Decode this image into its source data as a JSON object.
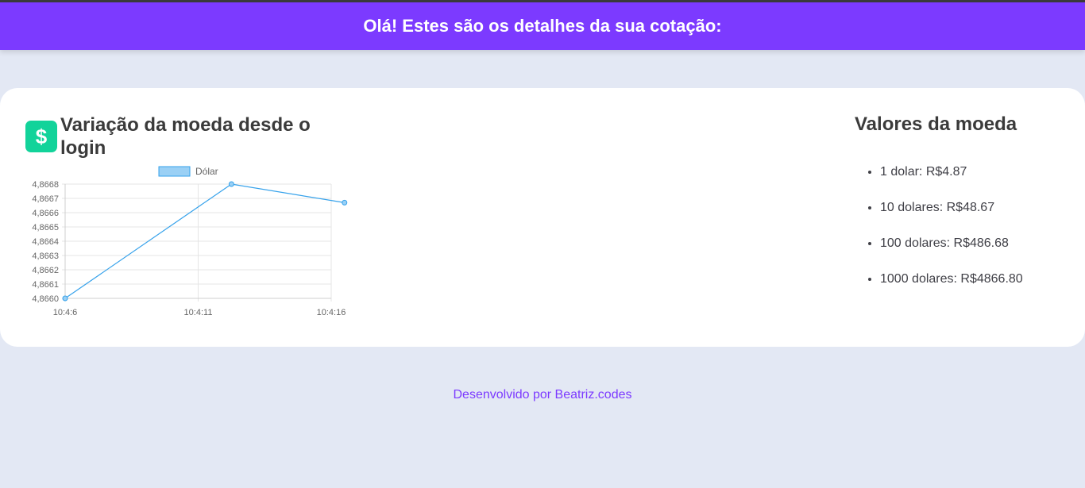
{
  "header": {
    "title": "Olá! Estes são os detalhes da sua cotação:"
  },
  "chart_section": {
    "icon": "dollar-sign-icon",
    "icon_glyph": "$",
    "title": "Variação da moeda desde o login"
  },
  "chart_data": {
    "type": "line",
    "title": "",
    "xlabel": "",
    "ylabel": "",
    "x_ticks": [
      "10:4:6",
      "10:4:11",
      "10:4:16"
    ],
    "y_ticks": [
      "4,8660",
      "4,8661",
      "4,8662",
      "4,8663",
      "4,8664",
      "4,8665",
      "4,8666",
      "4,8667",
      "4,8668"
    ],
    "ylim": [
      4.866,
      4.8668
    ],
    "xlim": [
      0,
      2
    ],
    "grid": true,
    "legend": "top-center",
    "series": [
      {
        "name": "Dólar",
        "color": "#36a2eb",
        "fill": "#9ad0f5",
        "points": [
          {
            "x": 0,
            "y": 4.866
          },
          {
            "x": 1.25,
            "y": 4.8668
          },
          {
            "x": 2.1,
            "y": 4.86667
          }
        ]
      }
    ]
  },
  "values_section": {
    "title": "Valores da moeda",
    "items": [
      "1 dolar: R$4.87",
      "10 dolares: R$48.67",
      "100 dolares: R$486.68",
      "1000 dolares: R$4866.80"
    ]
  },
  "footer": {
    "text": "Desenvolvido por Beatriz.codes"
  },
  "colors": {
    "header": "#7c3aff",
    "icon": "#12d39a",
    "background": "#e3e8f4",
    "footer_text": "#7c3aff"
  }
}
